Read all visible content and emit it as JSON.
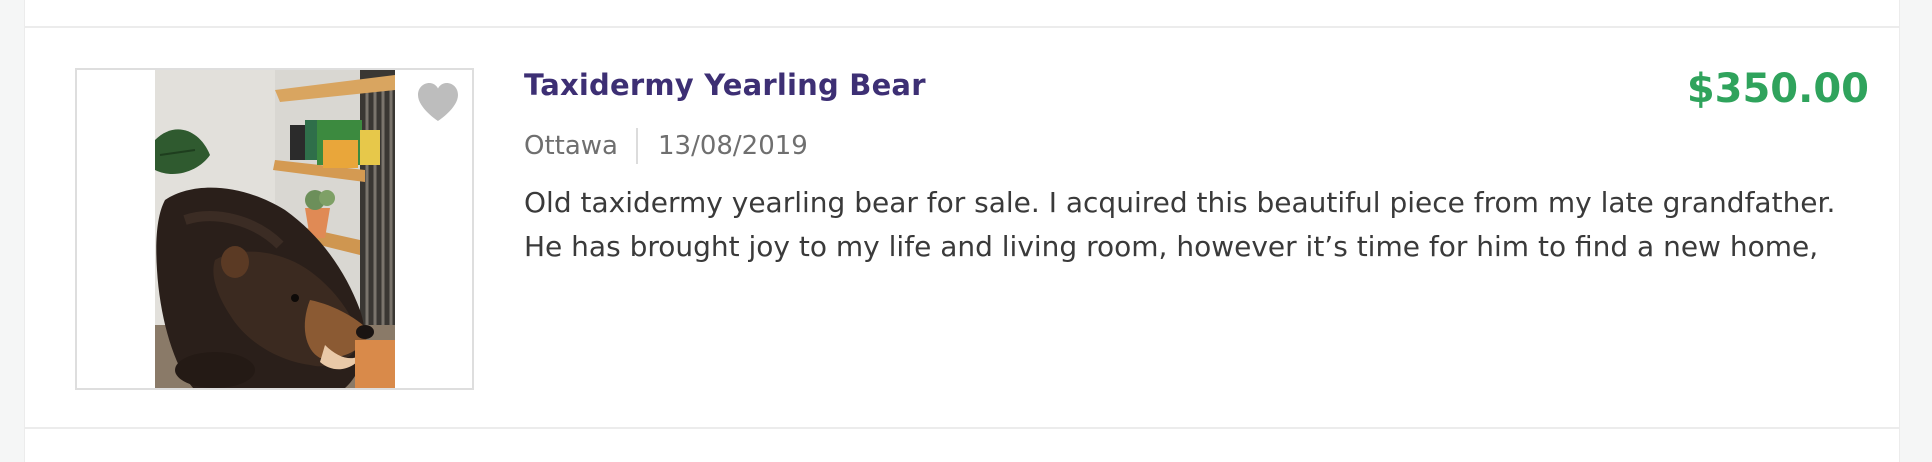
{
  "listing": {
    "title": "Taxidermy Yearling Bear",
    "price": "$350.00",
    "location": "Ottawa",
    "date": "13/08/2019",
    "description": "Old taxidermy yearling bear for sale. I acquired this beautiful piece from my late grandfather. He has brought joy to my life and living room, however it’s time for him to find a new home, that will …",
    "favorite_icon": "heart-icon",
    "image_alt": "Taxidermy Yearling Bear"
  },
  "colors": {
    "title": "#3d2f74",
    "price": "#2fa35c",
    "meta": "#6f6f6f",
    "description": "#3a3a3a",
    "heart": "#bdbdbd"
  }
}
